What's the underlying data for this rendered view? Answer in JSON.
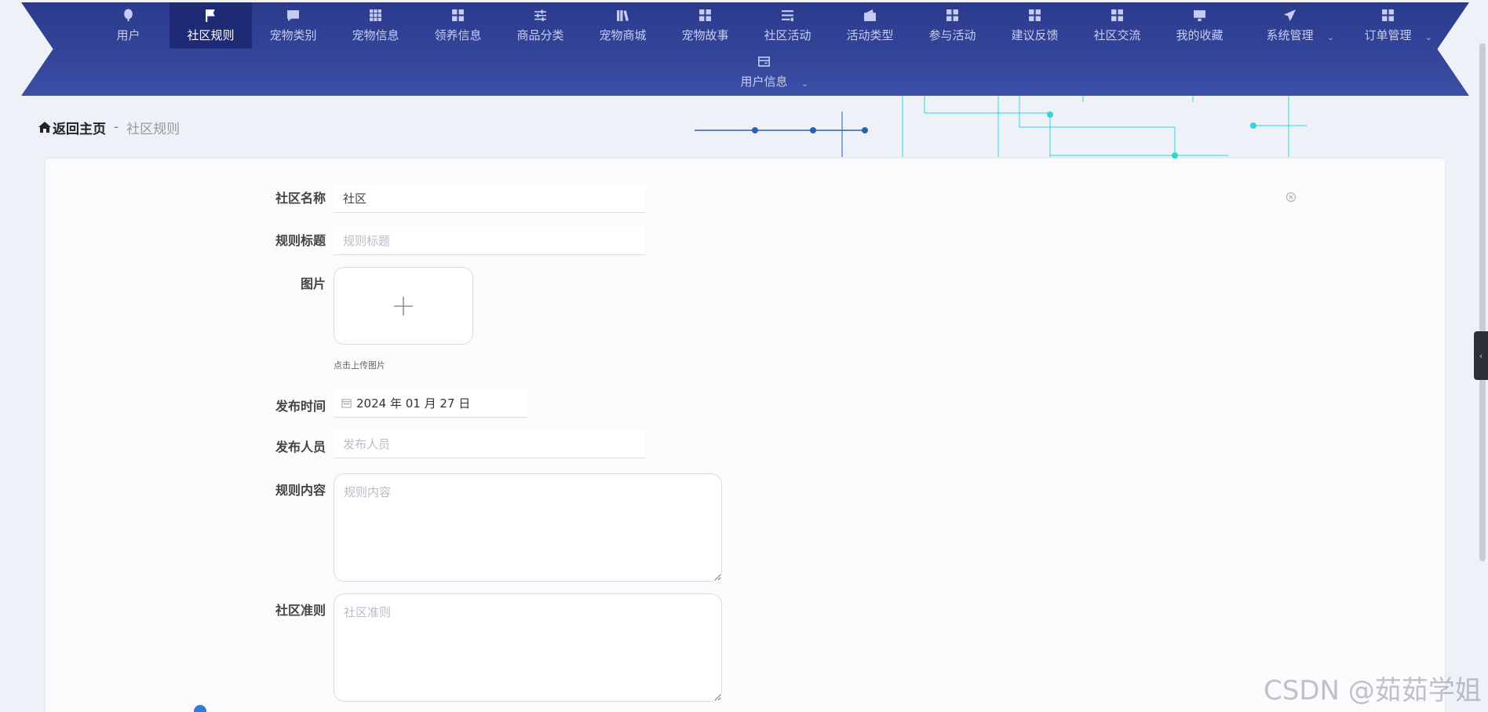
{
  "nav": {
    "items": [
      {
        "label": "用户",
        "icon": "balloon-icon"
      },
      {
        "label": "社区规则",
        "icon": "flag-icon",
        "active": true
      },
      {
        "label": "宠物类别",
        "icon": "chat-icon"
      },
      {
        "label": "宠物信息",
        "icon": "grid-icon"
      },
      {
        "label": "领养信息",
        "icon": "apps-icon"
      },
      {
        "label": "商品分类",
        "icon": "sliders-icon"
      },
      {
        "label": "宠物商城",
        "icon": "books-icon"
      },
      {
        "label": "宠物故事",
        "icon": "apps-icon"
      },
      {
        "label": "社区活动",
        "icon": "list-icon"
      },
      {
        "label": "活动类型",
        "icon": "wallet-icon"
      },
      {
        "label": "参与活动",
        "icon": "apps-icon"
      },
      {
        "label": "建议反馈",
        "icon": "apps-icon"
      },
      {
        "label": "社区交流",
        "icon": "apps-icon"
      },
      {
        "label": "我的收藏",
        "icon": "monitor-icon"
      },
      {
        "label": "系统管理",
        "icon": "send-icon",
        "dropdown": true
      },
      {
        "label": "订单管理",
        "icon": "apps-icon",
        "dropdown": true
      }
    ],
    "row2": [
      {
        "label": "用户信息",
        "icon": "card-icon",
        "dropdown": true
      }
    ]
  },
  "breadcrumb": {
    "home": "返回主页",
    "separator": "-",
    "current": "社区规则"
  },
  "form": {
    "community_name": {
      "label": "社区名称",
      "value": "社区",
      "placeholder": "社区名称"
    },
    "rule_title": {
      "label": "规则标题",
      "value": "",
      "placeholder": "规则标题"
    },
    "image": {
      "label": "图片",
      "tip": "点击上传图片"
    },
    "publish_time": {
      "label": "发布时间",
      "value": "2024 年 01 月 27 日"
    },
    "publisher": {
      "label": "发布人员",
      "value": "",
      "placeholder": "发布人员"
    },
    "rule_content": {
      "label": "规则内容",
      "placeholder": "规则内容"
    },
    "community_norms": {
      "label": "社区准则",
      "placeholder": "社区准则"
    }
  },
  "watermark": "CSDN @茹茹学姐",
  "colors": {
    "nav_bg": "#34469b",
    "nav_active": "#1f2a74",
    "accent_cyan": "#2fd8d8",
    "accent_blue": "#2d5fb0"
  }
}
